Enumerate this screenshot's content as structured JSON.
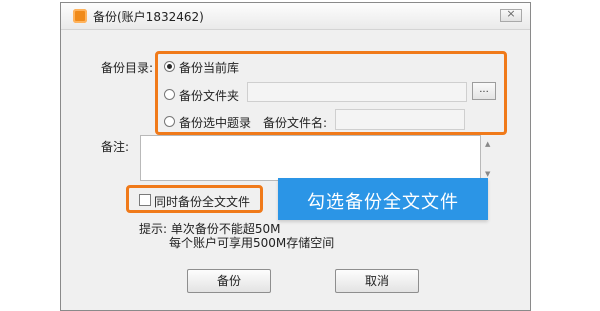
{
  "window": {
    "title": "备份(账户1832462)",
    "close_label": "×"
  },
  "backup_dir": {
    "label": "备份目录:",
    "options": [
      {
        "label": "备份当前库",
        "checked": true
      },
      {
        "label": "备份文件夹",
        "checked": false
      },
      {
        "label": "备份选中题录",
        "checked": false
      }
    ],
    "browse_label": "...",
    "filename_label": "备份文件名:",
    "filename_value": ""
  },
  "note": {
    "label": "备注:",
    "value": ""
  },
  "fulltext": {
    "label": "同时备份全文文件",
    "checked": false
  },
  "callout": {
    "text": "勾选备份全文文件"
  },
  "hint": {
    "line1": "提示: 单次备份不能超50M",
    "line2": "每个账户可享用500M存储空间"
  },
  "buttons": {
    "backup": "备份",
    "cancel": "取消"
  },
  "colors": {
    "highlight": "#f07a1a",
    "callout_bg": "#2b95e6"
  }
}
